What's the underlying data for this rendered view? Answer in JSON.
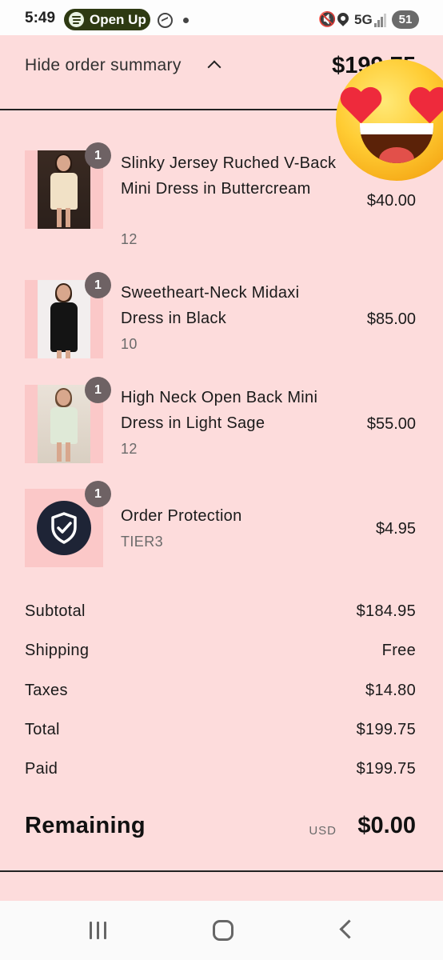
{
  "status_bar": {
    "time": "5:49",
    "pill_label": "Open Up",
    "network": "5G",
    "battery": "51"
  },
  "summary": {
    "toggle_label": "Hide order summary",
    "header_total": "$199.75"
  },
  "items": [
    {
      "qty": "1",
      "title": "Slinky Jersey Ruched V-Back Mini Dress in Buttercream",
      "variant": "12",
      "price": "$40.00"
    },
    {
      "qty": "1",
      "title": "Sweetheart-Neck Midaxi Dress in Black",
      "variant": "10",
      "price": "$85.00"
    },
    {
      "qty": "1",
      "title": "High Neck Open Back Mini Dress in Light Sage",
      "variant": "12",
      "price": "$55.00"
    },
    {
      "qty": "1",
      "title": "Order Protection",
      "variant": "TIER3",
      "price": "$4.95"
    }
  ],
  "totals": {
    "subtotal_label": "Subtotal",
    "subtotal_value": "$184.95",
    "shipping_label": "Shipping",
    "shipping_value": "Free",
    "taxes_label": "Taxes",
    "taxes_value": "$14.80",
    "total_label": "Total",
    "total_value": "$199.75",
    "paid_label": "Paid",
    "paid_value": "$199.75",
    "remaining_label": "Remaining",
    "remaining_currency": "USD",
    "remaining_value": "$0.00"
  },
  "colors": {
    "background": "#fddcdc",
    "thumbnail_bg": "#fbc8c8",
    "badge": "#6e6264",
    "shield": "#1e2436"
  }
}
